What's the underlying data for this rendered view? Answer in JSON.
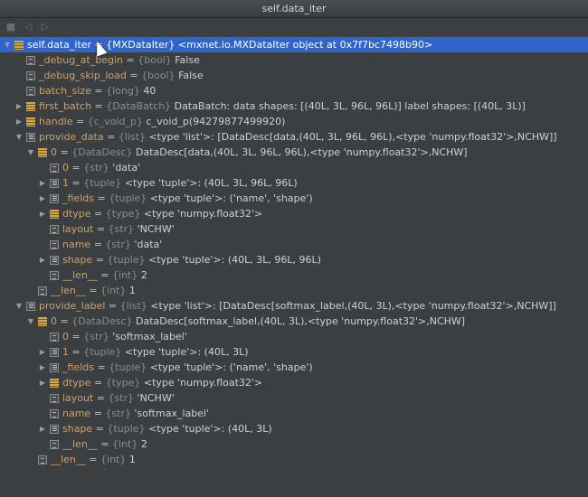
{
  "window": {
    "title": "self.data_iter"
  },
  "toolbar": {
    "icons": [
      "stop-icon",
      "back-icon",
      "forward-icon"
    ]
  },
  "rows": [
    {
      "depth": 0,
      "arrow": "down",
      "icon": "obj",
      "name": "self.data_iter",
      "type": "{MXDataIter}",
      "value": "<mxnet.io.MXDataIter object at 0x7f7bc7498b90>",
      "selected": true
    },
    {
      "depth": 1,
      "arrow": "",
      "icon": "field",
      "name": "_debug_at_begin",
      "type": "{bool}",
      "value": "False"
    },
    {
      "depth": 1,
      "arrow": "",
      "icon": "field",
      "name": "_debug_skip_load",
      "type": "{bool}",
      "value": "False"
    },
    {
      "depth": 1,
      "arrow": "",
      "icon": "field",
      "name": "batch_size",
      "type": "{long}",
      "value": "40"
    },
    {
      "depth": 1,
      "arrow": "right",
      "icon": "obj",
      "name": "first_batch",
      "type": "{DataBatch}",
      "value": "DataBatch: data shapes: [(40L, 3L, 96L, 96L)] label shapes: [(40L, 3L)]"
    },
    {
      "depth": 1,
      "arrow": "right",
      "icon": "obj",
      "name": "handle",
      "type": "{c_void_p}",
      "value": "c_void_p(94279877499920)"
    },
    {
      "depth": 1,
      "arrow": "down",
      "icon": "list",
      "name": "provide_data",
      "type": "{list}",
      "value": "<type 'list'>: [DataDesc[data,(40L, 3L, 96L, 96L),<type 'numpy.float32'>,NCHW]]"
    },
    {
      "depth": 2,
      "arrow": "down",
      "icon": "obj",
      "name": "0",
      "type": "{DataDesc}",
      "value": "DataDesc[data,(40L, 3L, 96L, 96L),<type 'numpy.float32'>,NCHW]"
    },
    {
      "depth": 3,
      "arrow": "",
      "icon": "field",
      "name": "0",
      "type": "{str}",
      "value": "'data'"
    },
    {
      "depth": 3,
      "arrow": "right",
      "icon": "list",
      "name": "1",
      "type": "{tuple}",
      "value": "<type 'tuple'>: (40L, 3L, 96L, 96L)"
    },
    {
      "depth": 3,
      "arrow": "right",
      "icon": "list",
      "name": "_fields",
      "type": "{tuple}",
      "value": "<type 'tuple'>: ('name', 'shape')"
    },
    {
      "depth": 3,
      "arrow": "right",
      "icon": "obj",
      "name": "dtype",
      "type": "{type}",
      "value": "<type 'numpy.float32'>"
    },
    {
      "depth": 3,
      "arrow": "",
      "icon": "field",
      "name": "layout",
      "type": "{str}",
      "value": "'NCHW'"
    },
    {
      "depth": 3,
      "arrow": "",
      "icon": "field",
      "name": "name",
      "type": "{str}",
      "value": "'data'"
    },
    {
      "depth": 3,
      "arrow": "right",
      "icon": "list",
      "name": "shape",
      "type": "{tuple}",
      "value": "<type 'tuple'>: (40L, 3L, 96L, 96L)"
    },
    {
      "depth": 3,
      "arrow": "",
      "icon": "field",
      "name": "__len__",
      "type": "{int}",
      "value": "2"
    },
    {
      "depth": 2,
      "arrow": "",
      "icon": "field",
      "name": "__len__",
      "type": "{int}",
      "value": "1"
    },
    {
      "depth": 1,
      "arrow": "down",
      "icon": "list",
      "name": "provide_label",
      "type": "{list}",
      "value": "<type 'list'>: [DataDesc[softmax_label,(40L, 3L),<type 'numpy.float32'>,NCHW]]"
    },
    {
      "depth": 2,
      "arrow": "down",
      "icon": "obj",
      "name": "0",
      "type": "{DataDesc}",
      "value": "DataDesc[softmax_label,(40L, 3L),<type 'numpy.float32'>,NCHW]"
    },
    {
      "depth": 3,
      "arrow": "",
      "icon": "field",
      "name": "0",
      "type": "{str}",
      "value": "'softmax_label'"
    },
    {
      "depth": 3,
      "arrow": "right",
      "icon": "list",
      "name": "1",
      "type": "{tuple}",
      "value": "<type 'tuple'>: (40L, 3L)"
    },
    {
      "depth": 3,
      "arrow": "right",
      "icon": "list",
      "name": "_fields",
      "type": "{tuple}",
      "value": "<type 'tuple'>: ('name', 'shape')"
    },
    {
      "depth": 3,
      "arrow": "right",
      "icon": "obj",
      "name": "dtype",
      "type": "{type}",
      "value": "<type 'numpy.float32'>"
    },
    {
      "depth": 3,
      "arrow": "",
      "icon": "field",
      "name": "layout",
      "type": "{str}",
      "value": "'NCHW'"
    },
    {
      "depth": 3,
      "arrow": "",
      "icon": "field",
      "name": "name",
      "type": "{str}",
      "value": "'softmax_label'"
    },
    {
      "depth": 3,
      "arrow": "right",
      "icon": "list",
      "name": "shape",
      "type": "{tuple}",
      "value": "<type 'tuple'>: (40L, 3L)"
    },
    {
      "depth": 3,
      "arrow": "",
      "icon": "field",
      "name": "__len__",
      "type": "{int}",
      "value": "2"
    },
    {
      "depth": 2,
      "arrow": "",
      "icon": "field",
      "name": "__len__",
      "type": "{int}",
      "value": "1"
    }
  ]
}
